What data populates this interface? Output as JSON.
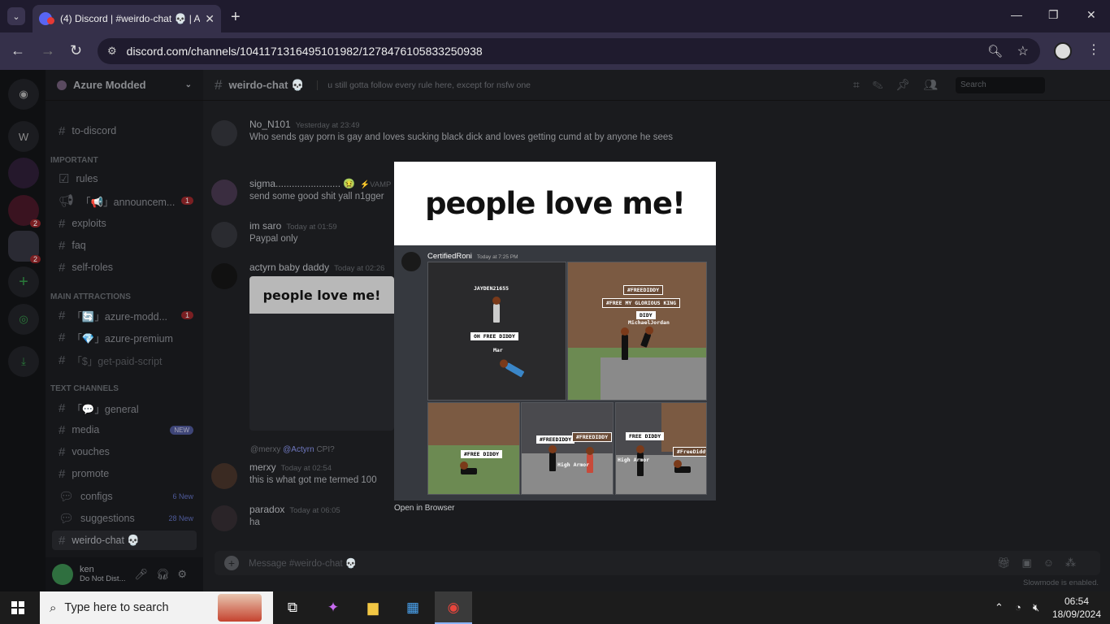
{
  "browser": {
    "tab_title": "(4) Discord | #weirdo-chat 💀 | A",
    "url": "discord.com/channels/1041171316495101982/1278476105833250938"
  },
  "server": {
    "name": "Azure Modded",
    "guild_badges": [
      "2",
      "2"
    ],
    "guild_letter": "W"
  },
  "channels": {
    "items": [
      {
        "label": "to-discord"
      },
      {
        "label": "rules"
      },
      {
        "label": "「📢」announcem...",
        "count": "1"
      },
      {
        "label": "exploits"
      },
      {
        "label": "faq"
      },
      {
        "label": "self-roles"
      },
      {
        "label": "「🔄」azure-modd...",
        "count": "1"
      },
      {
        "label": "「💎」azure-premium"
      },
      {
        "label": "「$」get-paid-script"
      },
      {
        "label": "「💬」general"
      },
      {
        "label": "media",
        "pill": "NEW"
      },
      {
        "label": "vouches"
      },
      {
        "label": "promote"
      },
      {
        "label": "configs",
        "new": "6 New"
      },
      {
        "label": "suggestions",
        "new": "28 New"
      },
      {
        "label": "weirdo-chat 💀"
      }
    ],
    "categories": [
      "IMPORTANT",
      "MAIN ATTRACTIONS",
      "TEXT CHANNELS"
    ]
  },
  "user": {
    "name": "ken",
    "status": "Do Not Dist..."
  },
  "chat": {
    "channel": "weirdo-chat 💀",
    "topic": "u still gotta follow every rule here, except for nsfw one",
    "search_placeholder": "Search",
    "composer_placeholder": "Message #weirdo-chat 💀",
    "slowmode": "Slowmode is enabled.",
    "messages": [
      {
        "author": "No_N101",
        "ts": "Yesterday at 23:49",
        "text": "Who sends gay porn is gay and loves sucking black dick and loves getting cumd at by anyone he sees"
      },
      {
        "author": "sigma........................ 🤢",
        "ts": "⚡VAMP",
        "text": "send some good shit yall n1gger"
      },
      {
        "author": "im saro",
        "ts": "Today at 01:59",
        "text": "Paypal only"
      },
      {
        "author": "actyrn baby daddy",
        "ts": "Today at 02:26",
        "text": ""
      },
      {
        "author": "merxy",
        "ts": "Today at 02:54",
        "text": "this is what got me termed 100"
      },
      {
        "author": "paradox",
        "ts": "Today at 06:05",
        "text": "ha"
      }
    ],
    "reply_preview": {
      "user": "@merxy",
      "mention": "@Actyrn",
      "text": "CPI?"
    },
    "embed_thumb_text": "people love me!"
  },
  "lightbox": {
    "headline": "people love me!",
    "inner_author": "CertifiedRoni",
    "inner_ts": "Today at 7:25 PM",
    "labels": {
      "p1_name": "JAYDEN21655",
      "p1_tag": "OH FREE DIDDY",
      "p1_sub": "Mar",
      "p2_a": "#FREEDIDDY",
      "p2_b": "#FREE MY GLORIOUS KING",
      "p2_c": "DIDY",
      "p2_d": "MichaelJordan",
      "p3_a": "#FREE DIDDY",
      "p4_a": "#FREEDIDDY",
      "p4_b": "#FREEDIDDY",
      "p4_c": "High Armor",
      "p5_a": "FREE DIDDY",
      "p5_b": "High Armor",
      "p5_c": "#FreeDiddy"
    },
    "open_in_browser": "Open in Browser"
  },
  "taskbar": {
    "search_placeholder": "Type here to search",
    "time": "06:54",
    "date": "18/09/2024"
  }
}
